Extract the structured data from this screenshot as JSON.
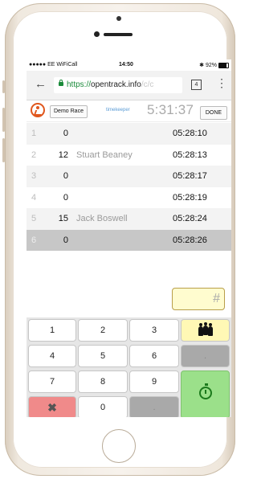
{
  "status_bar": {
    "carrier": "●●●●● EE WiFiCall",
    "time": "14:50",
    "battery": "92%",
    "bluetooth": "✱"
  },
  "browser": {
    "url_scheme": "https://",
    "url_host": "opentrack.info",
    "url_path": "/c/c",
    "tabs_count": "4"
  },
  "app_header": {
    "race_button": "Demo Race",
    "role": "timekeeper",
    "clock": "5:31:37",
    "done_button": "DONE"
  },
  "rows": [
    {
      "pos": "1",
      "bib": "0",
      "runner": "",
      "time": "05:28:10"
    },
    {
      "pos": "2",
      "bib": "12",
      "runner": "Stuart Beaney",
      "time": "05:28:13"
    },
    {
      "pos": "3",
      "bib": "0",
      "runner": "",
      "time": "05:28:17"
    },
    {
      "pos": "4",
      "bib": "0",
      "runner": "",
      "time": "05:28:19"
    },
    {
      "pos": "5",
      "bib": "15",
      "runner": "Jack Boswell",
      "time": "05:28:24"
    },
    {
      "pos": "6",
      "bib": "0",
      "runner": "",
      "time": "05:28:26"
    }
  ],
  "bib_input": {
    "placeholder": "#"
  },
  "keypad": {
    "k1": "1",
    "k2": "2",
    "k3": "3",
    "k4": "4",
    "k5": "5",
    "k6": "6",
    "k7": "7",
    "k8": "8",
    "k9": "9",
    "k0": "0",
    "dot": ".",
    "delete": "✖"
  },
  "icons": {
    "team": "team-icon",
    "timer": "stopwatch-icon",
    "back": "back-arrow-icon",
    "more": "more-vert-icon",
    "lock": "lock-icon"
  }
}
